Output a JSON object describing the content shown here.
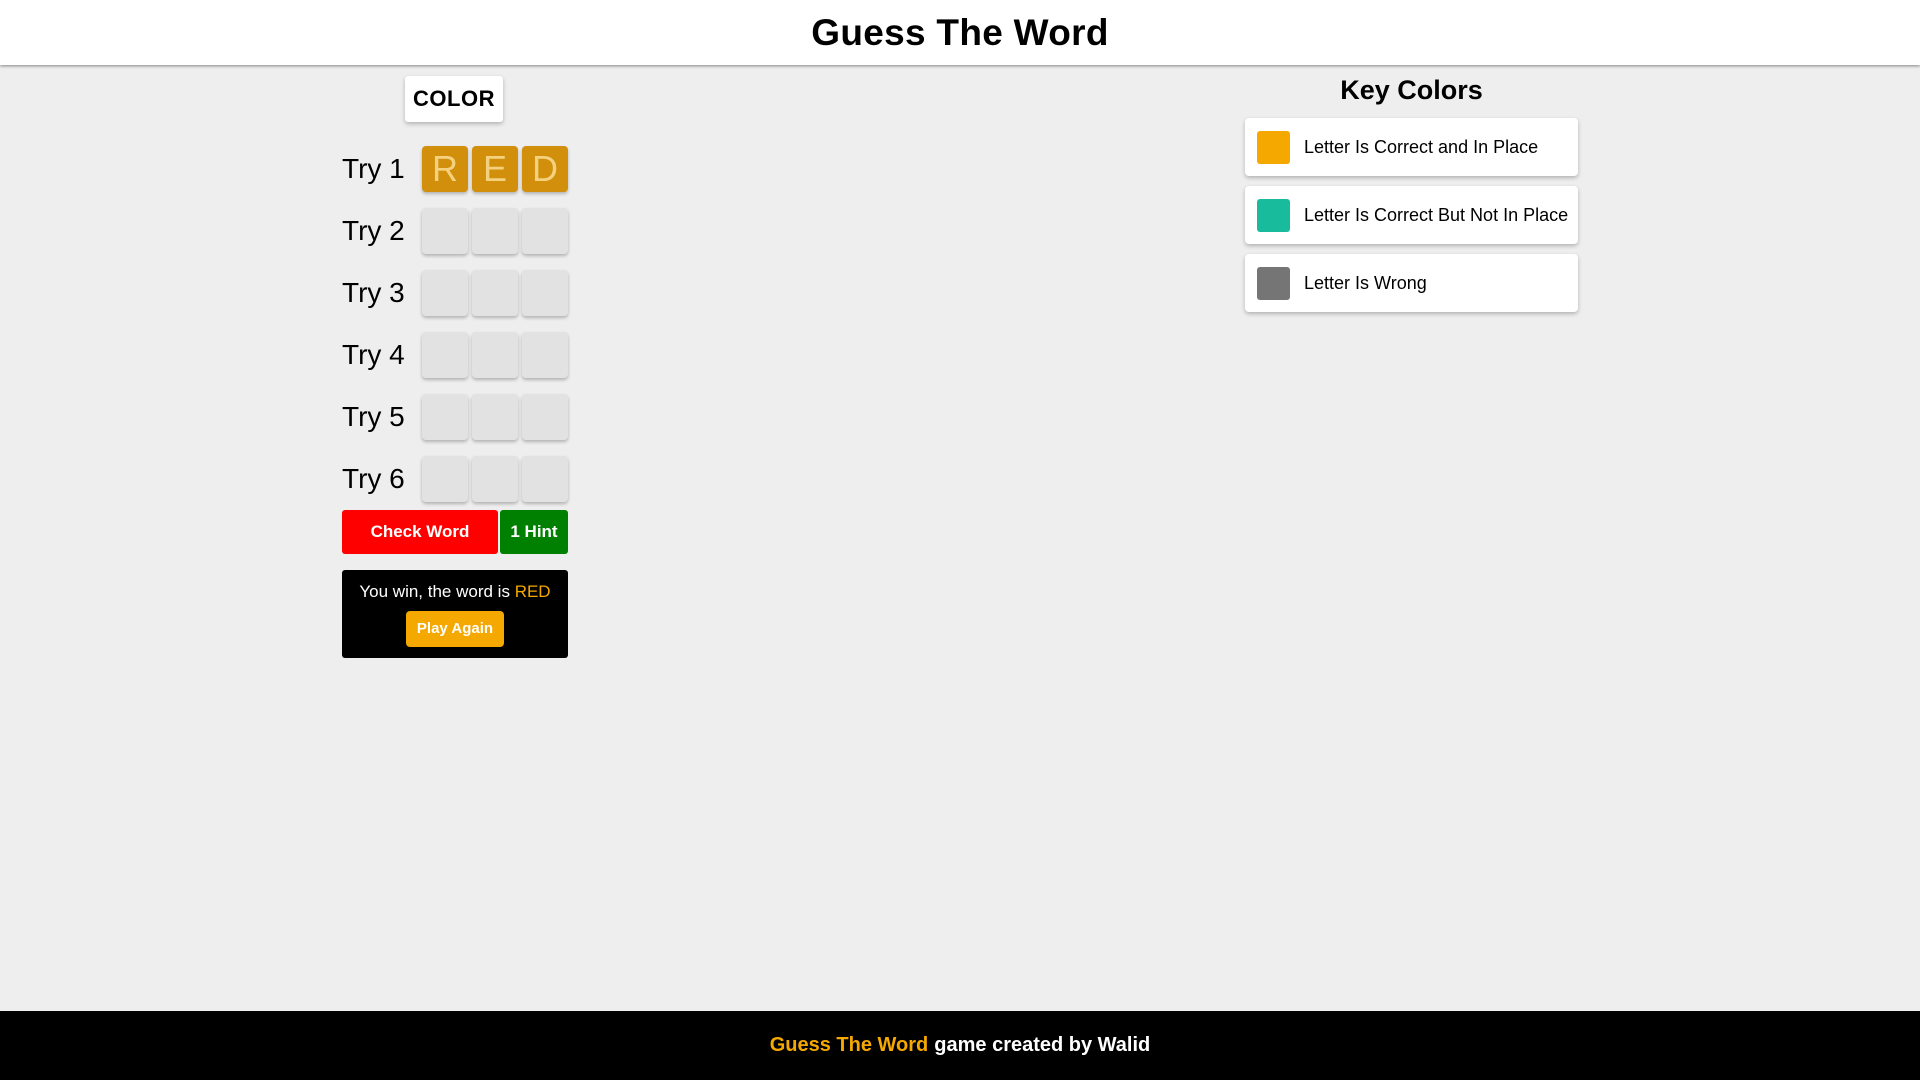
{
  "header": {
    "title": "Guess The Word"
  },
  "game": {
    "name": "COLOR",
    "tries": [
      {
        "label": "Try 1",
        "letters": [
          "R",
          "E",
          "D"
        ],
        "state": "in-place"
      },
      {
        "label": "Try 2",
        "letters": [
          "",
          "",
          ""
        ],
        "state": "empty"
      },
      {
        "label": "Try 3",
        "letters": [
          "",
          "",
          ""
        ],
        "state": "empty"
      },
      {
        "label": "Try 4",
        "letters": [
          "",
          "",
          ""
        ],
        "state": "empty"
      },
      {
        "label": "Try 5",
        "letters": [
          "",
          "",
          ""
        ],
        "state": "empty"
      },
      {
        "label": "Try 6",
        "letters": [
          "",
          "",
          ""
        ],
        "state": "empty"
      }
    ],
    "check_label": "Check Word",
    "hint_label": "1 Hint",
    "message": {
      "prefix": "You win, the word is ",
      "word": "RED",
      "play_again_label": "Play Again"
    }
  },
  "key_colors": {
    "title": "Key Colors",
    "items": [
      {
        "label": "Letter Is Correct and In Place",
        "color": "#f5a800"
      },
      {
        "label": "Letter Is Correct But Not In Place",
        "color": "#18bc9c"
      },
      {
        "label": "Letter Is Wrong",
        "color": "#757575"
      }
    ]
  },
  "footer": {
    "brand": "Guess The Word",
    "rest": "game created by Walid"
  },
  "colors": {
    "accent": "#f5a800",
    "check_button": "#ff0000",
    "hint_button": "#008000",
    "tile_in_place": "#d18f0b",
    "tile_empty": "#e2e2e2"
  }
}
